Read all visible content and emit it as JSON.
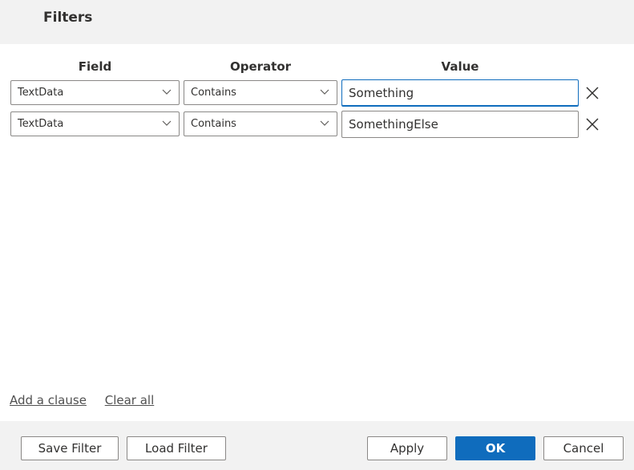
{
  "dialog": {
    "title": "Filters"
  },
  "columns": {
    "field": "Field",
    "operator": "Operator",
    "value": "Value"
  },
  "clauses": [
    {
      "field": "TextData",
      "operator": "Contains",
      "value": "Something",
      "focused": true
    },
    {
      "field": "TextData",
      "operator": "Contains",
      "value": "SomethingElse",
      "focused": false
    }
  ],
  "links": {
    "add_clause": "Add a clause",
    "clear_all": "Clear all"
  },
  "footer": {
    "save_filter": "Save Filter",
    "load_filter": "Load Filter",
    "apply": "Apply",
    "ok": "OK",
    "cancel": "Cancel"
  },
  "colors": {
    "primary": "#0f6cbd",
    "header_bg": "#f2f2f2",
    "border": "#8a8886"
  },
  "icons": {
    "dropdown": "chevron-down-icon",
    "remove": "close-icon"
  }
}
